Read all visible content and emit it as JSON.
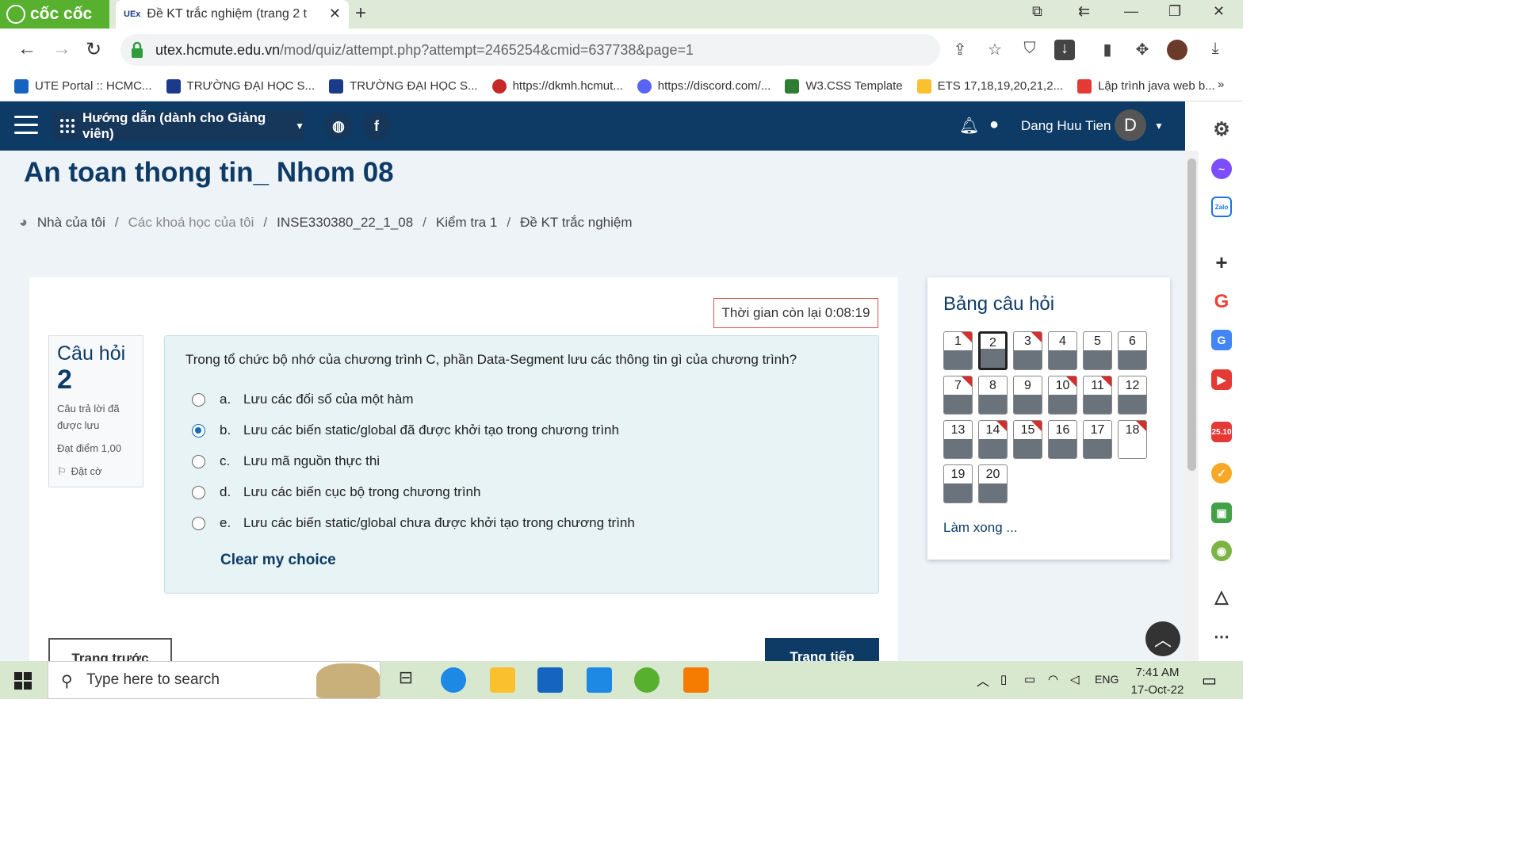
{
  "browser": {
    "brand": "cốc cốc",
    "tab_title": "Đề KT trắc nghiệm (trang 2 t",
    "tab_favicon": "UEx",
    "url_domain": "utex.hcmute.edu.vn",
    "url_path": "/mod/quiz/attempt.php?attempt=2465254&cmid=637738&page=1",
    "bookmarks": [
      {
        "label": "UTE Portal :: HCMC...",
        "color": "#1565c0"
      },
      {
        "label": "TRƯỜNG ĐẠI HỌC S...",
        "color": "#1b3a8a"
      },
      {
        "label": "TRƯỜNG ĐẠI HỌC S...",
        "color": "#1b3a8a"
      },
      {
        "label": "https://dkmh.hcmut...",
        "color": "#c62828"
      },
      {
        "label": "https://discord.com/...",
        "color": "#5865f2"
      },
      {
        "label": "W3.CSS Template",
        "color": "#2e7d32"
      },
      {
        "label": "ETS 17,18,19,20,21,2...",
        "color": "#fbc02d"
      },
      {
        "label": "Lập trình java web b...",
        "color": "#e53935"
      }
    ],
    "bookmarks_more": "»"
  },
  "site_nav": {
    "guide_label": "Hướng dẫn (dành cho Giảng viên)",
    "globe_icon": "globe-icon",
    "facebook_letter": "f",
    "user_name": "Dang Huu Tien",
    "avatar_letter": "D"
  },
  "page": {
    "course_title": "An toan thong tin_ Nhom 08",
    "breadcrumb": [
      "Nhà của tôi",
      "Các khoá học của tôi",
      "INSE330380_22_1_08",
      "Kiểm tra 1",
      "Đề KT trắc nghiệm"
    ],
    "breadcrumb_sep": "/"
  },
  "quiz": {
    "timer": "Thời gian còn lại 0:08:19",
    "question_label": "Câu hỏi",
    "question_number": "2",
    "status": "Câu trả lời đã được lưu",
    "marks": "Đạt điểm 1,00",
    "flag_label": "Đặt cờ",
    "question_text": "Trong tổ chức bộ nhớ của chương trình C, phần Data-Segment lưu các thông tin gì của chương trình?",
    "options": [
      {
        "letter": "a.",
        "text": "Lưu các đối số của một hàm",
        "selected": false
      },
      {
        "letter": "b.",
        "text": "Lưu các biến static/global đã được khởi tạo trong chương trình",
        "selected": true
      },
      {
        "letter": "c.",
        "text": "Lưu mã nguồn thực thi",
        "selected": false
      },
      {
        "letter": "d.",
        "text": "Lưu các biến cục bộ trong chương trình",
        "selected": false
      },
      {
        "letter": "e.",
        "text": "Lưu các biến static/global chưa được khởi tạo trong chương trình",
        "selected": false
      }
    ],
    "clear_choice": "Clear my choice",
    "prev_button": "Trang trước",
    "next_button": "Trang tiếp"
  },
  "navigation": {
    "title": "Bảng câu hỏi",
    "questions": [
      {
        "n": "1",
        "answered": true,
        "flagged": true
      },
      {
        "n": "2",
        "answered": true,
        "flagged": false,
        "current": true
      },
      {
        "n": "3",
        "answered": true,
        "flagged": true
      },
      {
        "n": "4",
        "answered": true,
        "flagged": false
      },
      {
        "n": "5",
        "answered": true,
        "flagged": false
      },
      {
        "n": "6",
        "answered": true,
        "flagged": false
      },
      {
        "n": "7",
        "answered": true,
        "flagged": true
      },
      {
        "n": "8",
        "answered": true,
        "flagged": false
      },
      {
        "n": "9",
        "answered": true,
        "flagged": false
      },
      {
        "n": "10",
        "answered": true,
        "flagged": true
      },
      {
        "n": "11",
        "answered": true,
        "flagged": true
      },
      {
        "n": "12",
        "answered": true,
        "flagged": false
      },
      {
        "n": "13",
        "answered": true,
        "flagged": false
      },
      {
        "n": "14",
        "answered": true,
        "flagged": true
      },
      {
        "n": "15",
        "answered": true,
        "flagged": true
      },
      {
        "n": "16",
        "answered": true,
        "flagged": false
      },
      {
        "n": "17",
        "answered": true,
        "flagged": false
      },
      {
        "n": "18",
        "answered": false,
        "flagged": true
      },
      {
        "n": "19",
        "answered": true,
        "flagged": false
      },
      {
        "n": "20",
        "answered": true,
        "flagged": false
      }
    ],
    "finish_link": "Làm xong ..."
  },
  "taskbar": {
    "search_placeholder": "Type here to search",
    "lang": "ENG",
    "time": "7:41 AM",
    "date": "17-Oct-22"
  },
  "side_panel": {
    "badge_text": "25.10"
  }
}
